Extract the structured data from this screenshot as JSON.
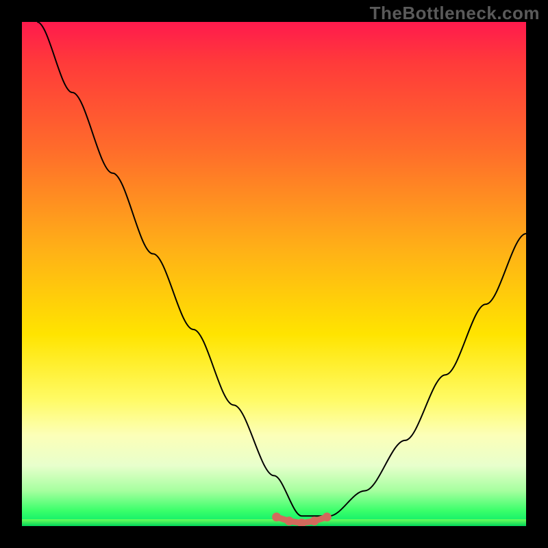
{
  "watermark": "TheBottleneck.com",
  "chart_data": {
    "type": "line",
    "title": "",
    "xlabel": "",
    "ylabel": "",
    "xlim": [
      0,
      1
    ],
    "ylim": [
      0,
      1
    ],
    "grid": false,
    "legend": false,
    "background_gradient": {
      "direction": "vertical",
      "stops": [
        {
          "pos": 0.0,
          "color": "#ff1a4d"
        },
        {
          "pos": 0.08,
          "color": "#ff3a3a"
        },
        {
          "pos": 0.25,
          "color": "#ff6b2b"
        },
        {
          "pos": 0.45,
          "color": "#ffb017"
        },
        {
          "pos": 0.62,
          "color": "#ffe400"
        },
        {
          "pos": 0.75,
          "color": "#fffb66"
        },
        {
          "pos": 0.82,
          "color": "#fcffb8"
        },
        {
          "pos": 0.88,
          "color": "#e8ffcc"
        },
        {
          "pos": 0.93,
          "color": "#a6ff9f"
        },
        {
          "pos": 0.97,
          "color": "#39ff6a"
        },
        {
          "pos": 1.0,
          "color": "#00e86b"
        }
      ]
    },
    "series": [
      {
        "name": "bottleneck-curve",
        "color": "#000000",
        "stroke_width": 2,
        "x": [
          0.03,
          0.1,
          0.18,
          0.26,
          0.34,
          0.42,
          0.5,
          0.555,
          0.61,
          0.68,
          0.76,
          0.84,
          0.92,
          1.0
        ],
        "y": [
          1.0,
          0.86,
          0.7,
          0.54,
          0.39,
          0.24,
          0.1,
          0.02,
          0.02,
          0.07,
          0.17,
          0.3,
          0.44,
          0.58
        ]
      },
      {
        "name": "floor-segment",
        "color": "#d26a5c",
        "stroke_width": 9,
        "x": [
          0.505,
          0.53,
          0.555,
          0.58,
          0.605
        ],
        "y": [
          0.018,
          0.01,
          0.006,
          0.01,
          0.018
        ],
        "style": "beaded"
      }
    ]
  }
}
